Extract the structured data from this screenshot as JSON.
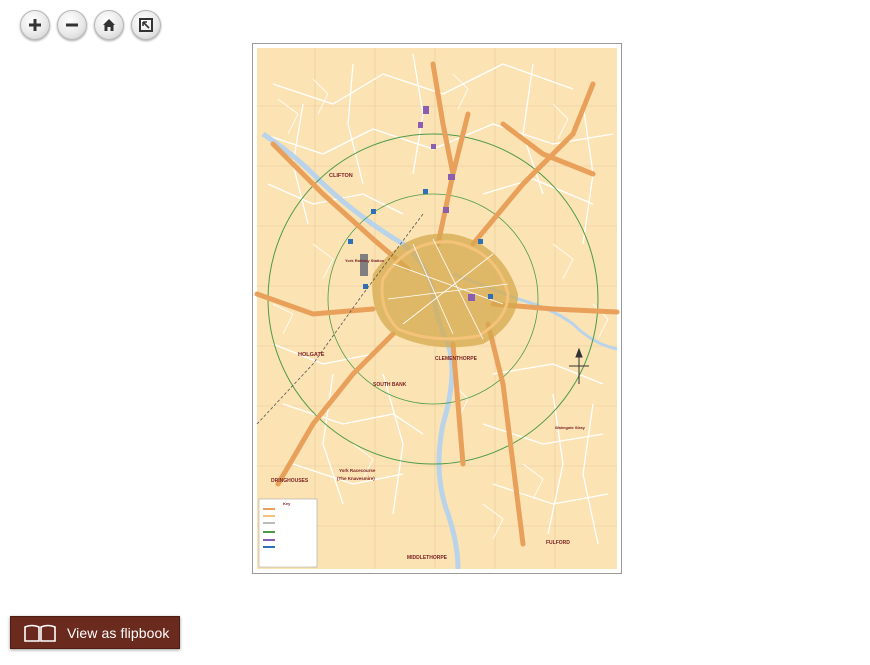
{
  "toolbar": {
    "buttons": [
      {
        "name": "zoom-in-button",
        "icon": "plus-icon"
      },
      {
        "name": "zoom-out-button",
        "icon": "minus-icon"
      },
      {
        "name": "home-button",
        "icon": "home-icon"
      },
      {
        "name": "fullscreen-button",
        "icon": "fullscreen-icon"
      }
    ]
  },
  "map": {
    "labels": {
      "clifton": "CLIFTON",
      "holgate": "HOLGATE",
      "south_bank": "SOUTH BANK",
      "clementhorpe": "CLEMENTHORPE",
      "dringhouses": "DRINGHOUSES",
      "middlethorpe": "MIDDLETHORPE",
      "fulford": "FULFORD",
      "racecourse": "York Racecourse",
      "racecourse_sub": "(The Knavesmire)",
      "station": "York Railway Station",
      "walmgate_stray": "Walmgate Stray",
      "key": "Key"
    },
    "colors": {
      "background": "#fbe3b4",
      "major_road": "#e8a05a",
      "river": "#b9d3ea",
      "ring": "#4c9a47",
      "streets": "#ffffff",
      "city_centre": "#d6a94e"
    }
  },
  "flipbook": {
    "label": "View as flipbook",
    "icon": "open-book-icon"
  }
}
